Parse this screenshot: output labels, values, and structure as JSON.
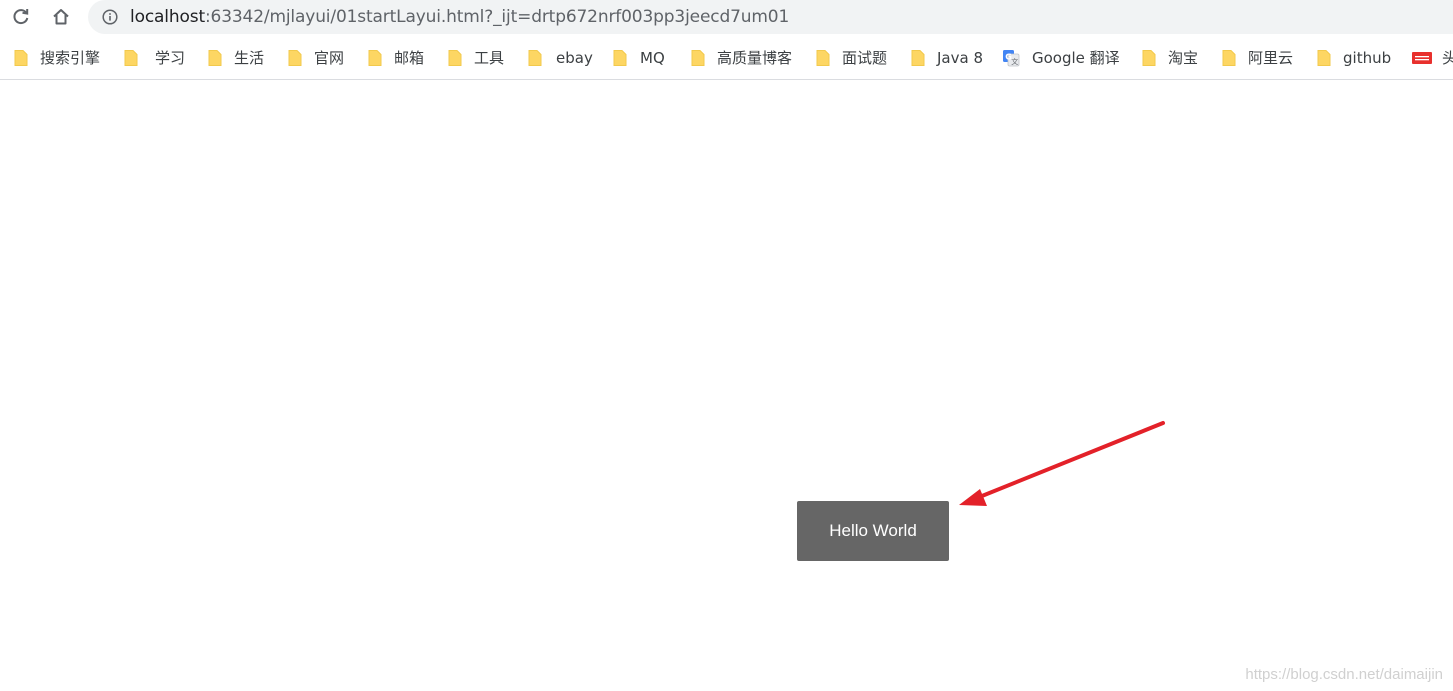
{
  "toolbar": {
    "reload_icon": "reload-icon",
    "home_icon": "home-icon",
    "info_icon": "info-icon",
    "url_host": "localhost",
    "url_rest": ":63342/mjlayui/01startLayui.html?_ijt=drtp672nrf003pp3jeecd7um01"
  },
  "bookmarks": [
    {
      "label": "搜索引擎",
      "icon": "folder-icon"
    },
    {
      "label": "学习",
      "icon": "folder-icon"
    },
    {
      "label": "生活",
      "icon": "folder-icon"
    },
    {
      "label": "官网",
      "icon": "folder-icon"
    },
    {
      "label": "邮箱",
      "icon": "folder-icon"
    },
    {
      "label": "工具",
      "icon": "folder-icon"
    },
    {
      "label": "ebay",
      "icon": "folder-icon"
    },
    {
      "label": "MQ",
      "icon": "folder-icon"
    },
    {
      "label": "高质量博客",
      "icon": "folder-icon"
    },
    {
      "label": "面试题",
      "icon": "folder-icon"
    },
    {
      "label": "Java 8",
      "icon": "folder-icon"
    },
    {
      "label": "Google 翻译",
      "icon": "google-translate-icon"
    },
    {
      "label": "淘宝",
      "icon": "folder-icon"
    },
    {
      "label": "阿里云",
      "icon": "folder-icon"
    },
    {
      "label": "github",
      "icon": "folder-icon"
    },
    {
      "label": "头",
      "icon": "toutiao-icon"
    }
  ],
  "page": {
    "button_label": "Hello World",
    "arrow_color": "#e32129",
    "watermark": "https://blog.csdn.net/daimaijin"
  },
  "colors": {
    "button_bg": "#666666",
    "folder": "#fdd663",
    "omnibox_bg": "#f1f3f4"
  }
}
